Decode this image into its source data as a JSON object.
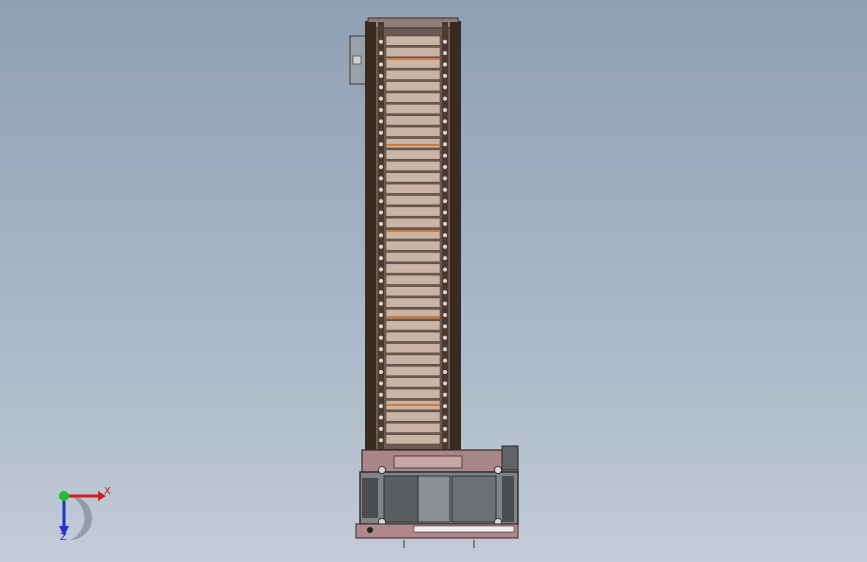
{
  "viewport": {
    "background_top": "#8f9fb4",
    "background_bottom": "#c3ccd7"
  },
  "model": {
    "frame_color": "#3b2a22",
    "slat_color": "#c9b4a6",
    "base_color": "#a8868a",
    "motor_color": "#5a5e62",
    "accent_color": "#d27a3a"
  },
  "triad": {
    "x_label": "X",
    "z_label": "Z",
    "x_color": "#d21f1f",
    "y_color": "#1fbf2f",
    "z_color": "#2233cc"
  }
}
